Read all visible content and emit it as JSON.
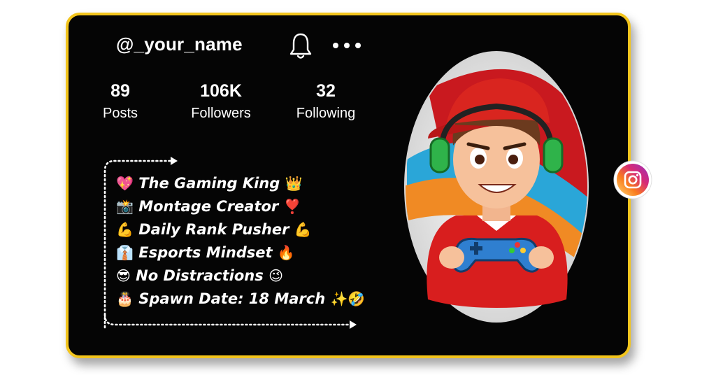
{
  "profile": {
    "username": "@_your_name",
    "stats": [
      {
        "value": "89",
        "label": "Posts"
      },
      {
        "value": "106K",
        "label": "Followers"
      },
      {
        "value": "32",
        "label": "Following"
      }
    ],
    "bio": [
      {
        "emoji_before": "💖",
        "text": "The Gaming King",
        "emoji_after": "👑"
      },
      {
        "emoji_before": "📸",
        "text": "Montage Creator",
        "emoji_after": "❣️"
      },
      {
        "emoji_before": "💪",
        "text": "Daily Rank Pusher",
        "emoji_after": "💪"
      },
      {
        "emoji_before": "👔",
        "text": "Esports Mindset",
        "emoji_after": "🔥"
      },
      {
        "emoji_before": "😎",
        "text": "No Distractions",
        "emoji_after": "😉"
      },
      {
        "emoji_before": "🎂",
        "text": "Spawn Date: 18 March",
        "emoji_after": "✨🤣"
      }
    ]
  },
  "icons": {
    "notification": "bell-icon",
    "more": "more-dots-icon",
    "social": "instagram-icon",
    "avatar": "gamer-boy-avatar"
  },
  "colors": {
    "card_border": "#f3c51d",
    "card_background": "#050505",
    "text": "#ffffff"
  }
}
